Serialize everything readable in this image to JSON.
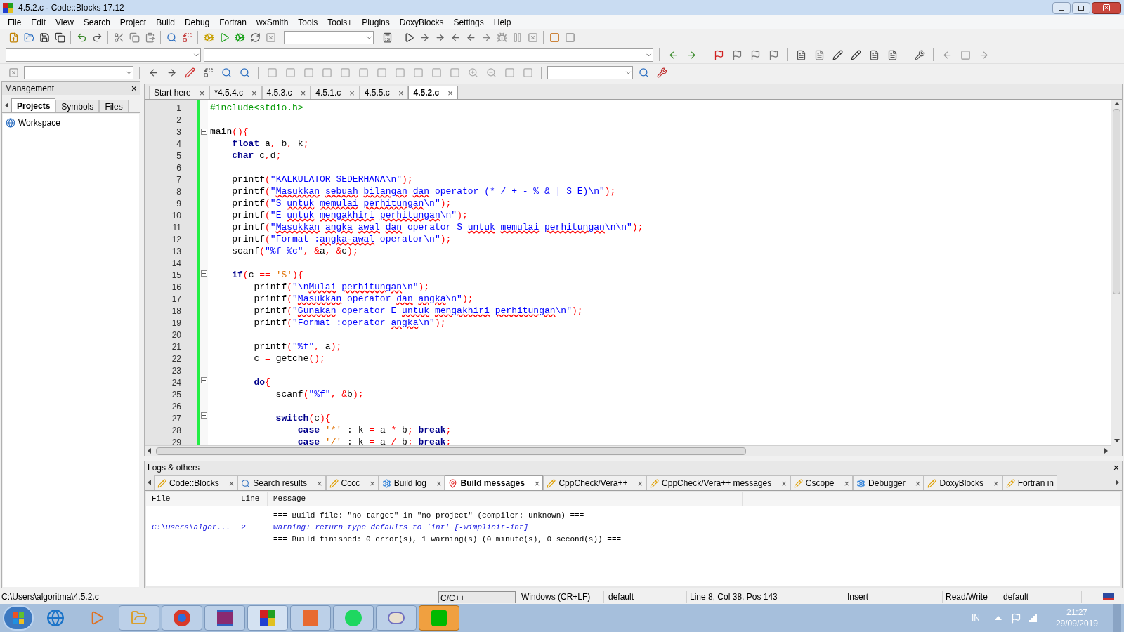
{
  "window": {
    "title": "4.5.2.c - Code::Blocks 17.12"
  },
  "menu": [
    "File",
    "Edit",
    "View",
    "Search",
    "Project",
    "Build",
    "Debug",
    "Fortran",
    "wxSmith",
    "Tools",
    "Tools+",
    "Plugins",
    "DoxyBlocks",
    "Settings",
    "Help"
  ],
  "management": {
    "title": "Management",
    "close": "×",
    "tabs": [
      {
        "label": "Projects",
        "selected": true
      },
      {
        "label": "Symbols",
        "selected": false
      },
      {
        "label": "Files",
        "selected": false
      }
    ],
    "tree": [
      {
        "label": "Workspace"
      }
    ]
  },
  "editor_tabs": [
    {
      "label": "Start here",
      "close": "×",
      "selected": false
    },
    {
      "label": "*4.5.4.c",
      "close": "×",
      "selected": false
    },
    {
      "label": "4.5.3.c",
      "close": "×",
      "selected": false
    },
    {
      "label": "4.5.1.c",
      "close": "×",
      "selected": false
    },
    {
      "label": "4.5.5.c",
      "close": "×",
      "selected": false
    },
    {
      "label": "4.5.2.c",
      "close": "×",
      "selected": true
    }
  ],
  "code": [
    {
      "number": "1",
      "fold": false,
      "tokens": [
        {
          "kind": "preprocessor",
          "text": "#include<stdio.h>"
        }
      ]
    },
    {
      "number": "2",
      "fold": false
    },
    {
      "number": "3",
      "fold": true,
      "tokens": [
        {
          "kind": "identifier",
          "text": "main"
        },
        {
          "kind": "operator",
          "text": "(){"
        }
      ]
    },
    {
      "number": "4",
      "fold": false,
      "tokens": [
        {
          "kind": "keyword",
          "text": "    float"
        },
        {
          "kind": "identifier",
          "text": " a"
        },
        {
          "kind": "operator",
          "text": ","
        },
        {
          "kind": "identifier",
          "text": " b"
        },
        {
          "kind": "operator",
          "text": ","
        },
        {
          "kind": "identifier",
          "text": " k"
        },
        {
          "kind": "operator",
          "text": ";"
        }
      ]
    },
    {
      "number": "5",
      "fold": false,
      "tokens": [
        {
          "kind": "keyword",
          "text": "    char"
        },
        {
          "kind": "identifier",
          "text": " c"
        },
        {
          "kind": "operator",
          "text": ","
        },
        {
          "kind": "identifier",
          "text": "d"
        },
        {
          "kind": "operator",
          "text": ";"
        }
      ]
    },
    {
      "number": "6",
      "fold": false
    },
    {
      "number": "7",
      "fold": false,
      "tokens": [
        {
          "kind": "identifier",
          "text": "    printf"
        },
        {
          "kind": "operator",
          "text": "("
        },
        {
          "kind": "string",
          "text": "\"KALKULATOR SEDERHANA\\n\""
        },
        {
          "kind": "operator",
          "text": ");"
        }
      ]
    },
    {
      "number": "8",
      "fold": false,
      "tokens": [
        {
          "kind": "identifier",
          "text": "    printf"
        },
        {
          "kind": "operator",
          "text": "("
        },
        {
          "kind": "string",
          "text": "\""
        },
        {
          "kind": "misspelled",
          "text": "Masukkan "
        },
        {
          "kind": "misspelled",
          "text": "sebuah "
        },
        {
          "kind": "misspelled",
          "text": "bilangan "
        },
        {
          "kind": "misspelled",
          "text": "dan"
        },
        {
          "kind": "string",
          "text": " operator (* / + - % & | S E)\\n\""
        },
        {
          "kind": "operator",
          "text": ");"
        }
      ]
    },
    {
      "number": "9",
      "fold": false,
      "tokens": [
        {
          "kind": "identifier",
          "text": "    printf"
        },
        {
          "kind": "operator",
          "text": "("
        },
        {
          "kind": "string",
          "text": "\"S "
        },
        {
          "kind": "misspelled",
          "text": "untuk "
        },
        {
          "kind": "misspelled",
          "text": "memulai "
        },
        {
          "kind": "misspelled",
          "text": "perhitungan"
        },
        {
          "kind": "string",
          "text": "\\n\""
        },
        {
          "kind": "operator",
          "text": ");"
        }
      ]
    },
    {
      "number": "10",
      "fold": false,
      "tokens": [
        {
          "kind": "identifier",
          "text": "    printf"
        },
        {
          "kind": "operator",
          "text": "("
        },
        {
          "kind": "string",
          "text": "\"E "
        },
        {
          "kind": "misspelled",
          "text": "untuk "
        },
        {
          "kind": "misspelled",
          "text": "mengakhiri "
        },
        {
          "kind": "misspelled",
          "text": "perhitungan"
        },
        {
          "kind": "string",
          "text": "\\n\""
        },
        {
          "kind": "operator",
          "text": ");"
        }
      ]
    },
    {
      "number": "11",
      "fold": false,
      "tokens": [
        {
          "kind": "identifier",
          "text": "    printf"
        },
        {
          "kind": "operator",
          "text": "("
        },
        {
          "kind": "string",
          "text": "\""
        },
        {
          "kind": "misspelled",
          "text": "Masukkan "
        },
        {
          "kind": "misspelled",
          "text": "angka "
        },
        {
          "kind": "misspelled",
          "text": "awal "
        },
        {
          "kind": "misspelled",
          "text": "dan"
        },
        {
          "kind": "string",
          "text": " operator S "
        },
        {
          "kind": "misspelled",
          "text": "untuk "
        },
        {
          "kind": "misspelled",
          "text": "memulai "
        },
        {
          "kind": "misspelled",
          "text": "perhitungan"
        },
        {
          "kind": "string",
          "text": "\\n\\n\""
        },
        {
          "kind": "operator",
          "text": ");"
        }
      ]
    },
    {
      "number": "12",
      "fold": false,
      "tokens": [
        {
          "kind": "identifier",
          "text": "    printf"
        },
        {
          "kind": "operator",
          "text": "("
        },
        {
          "kind": "string",
          "text": "\"Format :"
        },
        {
          "kind": "misspelled",
          "text": "angka-awal"
        },
        {
          "kind": "string",
          "text": " operator\\n\""
        },
        {
          "kind": "operator",
          "text": ");"
        }
      ]
    },
    {
      "number": "13",
      "fold": false,
      "tokens": [
        {
          "kind": "identifier",
          "text": "    scanf"
        },
        {
          "kind": "operator",
          "text": "("
        },
        {
          "kind": "string",
          "text": "\"%f %c\""
        },
        {
          "kind": "operator",
          "text": ", &"
        },
        {
          "kind": "identifier",
          "text": "a"
        },
        {
          "kind": "operator",
          "text": ", &"
        },
        {
          "kind": "identifier",
          "text": "c"
        },
        {
          "kind": "operator",
          "text": ");"
        }
      ]
    },
    {
      "number": "14",
      "fold": false
    },
    {
      "number": "15",
      "fold": true,
      "tokens": [
        {
          "kind": "keyword",
          "text": "    if"
        },
        {
          "kind": "operator",
          "text": "("
        },
        {
          "kind": "identifier",
          "text": "c "
        },
        {
          "kind": "operator",
          "text": "=="
        },
        {
          "kind": "char",
          "text": " 'S'"
        },
        {
          "kind": "operator",
          "text": "){"
        }
      ]
    },
    {
      "number": "16",
      "fold": false,
      "tokens": [
        {
          "kind": "identifier",
          "text": "        printf"
        },
        {
          "kind": "operator",
          "text": "("
        },
        {
          "kind": "string",
          "text": "\"\\n"
        },
        {
          "kind": "misspelled",
          "text": "Mulai "
        },
        {
          "kind": "misspelled",
          "text": "perhitungan"
        },
        {
          "kind": "string",
          "text": "\\n\""
        },
        {
          "kind": "operator",
          "text": ");"
        }
      ]
    },
    {
      "number": "17",
      "fold": false,
      "tokens": [
        {
          "kind": "identifier",
          "text": "        printf"
        },
        {
          "kind": "operator",
          "text": "("
        },
        {
          "kind": "string",
          "text": "\""
        },
        {
          "kind": "misspelled",
          "text": "Masukkan"
        },
        {
          "kind": "string",
          "text": " operator "
        },
        {
          "kind": "misspelled",
          "text": "dan "
        },
        {
          "kind": "misspelled",
          "text": "angka"
        },
        {
          "kind": "string",
          "text": "\\n\""
        },
        {
          "kind": "operator",
          "text": ");"
        }
      ]
    },
    {
      "number": "18",
      "fold": false,
      "tokens": [
        {
          "kind": "identifier",
          "text": "        printf"
        },
        {
          "kind": "operator",
          "text": "("
        },
        {
          "kind": "string",
          "text": "\""
        },
        {
          "kind": "misspelled",
          "text": "Gunakan"
        },
        {
          "kind": "string",
          "text": " operator E "
        },
        {
          "kind": "misspelled",
          "text": "untuk "
        },
        {
          "kind": "misspelled",
          "text": "mengakhiri "
        },
        {
          "kind": "misspelled",
          "text": "perhitungan"
        },
        {
          "kind": "string",
          "text": "\\n\""
        },
        {
          "kind": "operator",
          "text": ");"
        }
      ]
    },
    {
      "number": "19",
      "fold": false,
      "tokens": [
        {
          "kind": "identifier",
          "text": "        printf"
        },
        {
          "kind": "operator",
          "text": "("
        },
        {
          "kind": "string",
          "text": "\"Format :operator "
        },
        {
          "kind": "misspelled",
          "text": "angka"
        },
        {
          "kind": "string",
          "text": "\\n\""
        },
        {
          "kind": "operator",
          "text": ");"
        }
      ]
    },
    {
      "number": "20",
      "fold": false
    },
    {
      "number": "21",
      "fold": false,
      "tokens": [
        {
          "kind": "identifier",
          "text": "        printf"
        },
        {
          "kind": "operator",
          "text": "("
        },
        {
          "kind": "string",
          "text": "\"%f\""
        },
        {
          "kind": "operator",
          "text": ","
        },
        {
          "kind": "identifier",
          "text": " a"
        },
        {
          "kind": "operator",
          "text": ");"
        }
      ]
    },
    {
      "number": "22",
      "fold": false,
      "tokens": [
        {
          "kind": "identifier",
          "text": "        c "
        },
        {
          "kind": "operator",
          "text": "="
        },
        {
          "kind": "identifier",
          "text": " getche"
        },
        {
          "kind": "operator",
          "text": "();"
        }
      ]
    },
    {
      "number": "23",
      "fold": false
    },
    {
      "number": "24",
      "fold": true,
      "tokens": [
        {
          "kind": "keyword",
          "text": "        do"
        },
        {
          "kind": "operator",
          "text": "{"
        }
      ]
    },
    {
      "number": "25",
      "fold": false,
      "tokens": [
        {
          "kind": "identifier",
          "text": "            scanf"
        },
        {
          "kind": "operator",
          "text": "("
        },
        {
          "kind": "string",
          "text": "\"%f\""
        },
        {
          "kind": "operator",
          "text": ", &"
        },
        {
          "kind": "identifier",
          "text": "b"
        },
        {
          "kind": "operator",
          "text": ");"
        }
      ]
    },
    {
      "number": "26",
      "fold": false
    },
    {
      "number": "27",
      "fold": true,
      "tokens": [
        {
          "kind": "keyword",
          "text": "            switch"
        },
        {
          "kind": "operator",
          "text": "("
        },
        {
          "kind": "identifier",
          "text": "c"
        },
        {
          "kind": "operator",
          "text": "){"
        }
      ]
    },
    {
      "number": "28",
      "fold": false,
      "tokens": [
        {
          "kind": "keyword",
          "text": "                case"
        },
        {
          "kind": "char",
          "text": " '*'"
        },
        {
          "kind": "identifier",
          "text": " : k "
        },
        {
          "kind": "operator",
          "text": "="
        },
        {
          "kind": "identifier",
          "text": " a "
        },
        {
          "kind": "operator",
          "text": "*"
        },
        {
          "kind": "identifier",
          "text": " b"
        },
        {
          "kind": "operator",
          "text": ";"
        },
        {
          "kind": "keyword",
          "text": " break"
        },
        {
          "kind": "operator",
          "text": ";"
        }
      ]
    },
    {
      "number": "29",
      "fold": false,
      "tokens": [
        {
          "kind": "keyword",
          "text": "                case"
        },
        {
          "kind": "char",
          "text": " '/'"
        },
        {
          "kind": "identifier",
          "text": " : k "
        },
        {
          "kind": "operator",
          "text": "="
        },
        {
          "kind": "identifier",
          "text": " a "
        },
        {
          "kind": "operator",
          "text": "/"
        },
        {
          "kind": "identifier",
          "text": " b"
        },
        {
          "kind": "operator",
          "text": ";"
        },
        {
          "kind": "keyword",
          "text": " break"
        },
        {
          "kind": "operator",
          "text": ";"
        }
      ]
    }
  ],
  "logs": {
    "title": "Logs & others",
    "close": "×",
    "tabs": [
      {
        "label": "Code::Blocks",
        "close": "×",
        "kind": "log",
        "selected": false
      },
      {
        "label": "Search results",
        "close": "×",
        "kind": "search",
        "selected": false
      },
      {
        "label": "Cccc",
        "close": "×",
        "kind": "log",
        "selected": false
      },
      {
        "label": "Build log",
        "close": "×",
        "kind": "gear",
        "selected": false
      },
      {
        "label": "Build messages",
        "close": "×",
        "kind": "pin",
        "selected": true
      },
      {
        "label": "CppCheck/Vera++",
        "close": "×",
        "kind": "log",
        "selected": false
      },
      {
        "label": "CppCheck/Vera++ messages",
        "close": "×",
        "kind": "log",
        "selected": false
      },
      {
        "label": "Cscope",
        "close": "×",
        "kind": "log",
        "selected": false
      },
      {
        "label": "Debugger",
        "close": "×",
        "kind": "gear",
        "selected": false
      },
      {
        "label": "DoxyBlocks",
        "close": "×",
        "kind": "log",
        "selected": false
      },
      {
        "label": "Fortran in",
        "kind": "log",
        "selected": false
      }
    ],
    "columns": [
      "File",
      "Line",
      "Message"
    ],
    "rows": [
      {
        "kind": "info",
        "message": "=== Build file: \"no target\" in \"no project\" (compiler: unknown) ==="
      },
      {
        "kind": "warning",
        "file": "C:\\Users\\algor...",
        "line": "2",
        "message": "warning: return type defaults to 'int' [-Wimplicit-int]"
      },
      {
        "kind": "info",
        "message": "=== Build finished: 0 error(s), 1 warning(s) (0 minute(s), 0 second(s)) ==="
      }
    ]
  },
  "status_bar": {
    "path": "C:\\Users\\algoritma\\4.5.2.c",
    "language": "C/C++",
    "line_endings": "Windows (CR+LF)",
    "encoding": "default",
    "position": "Line 8, Col 38, Pos 143",
    "mode": "Insert",
    "access": "Read/Write",
    "profile": "default"
  },
  "taskbar": {
    "language": "IN",
    "time": "21:27",
    "date": "29/09/2019"
  }
}
